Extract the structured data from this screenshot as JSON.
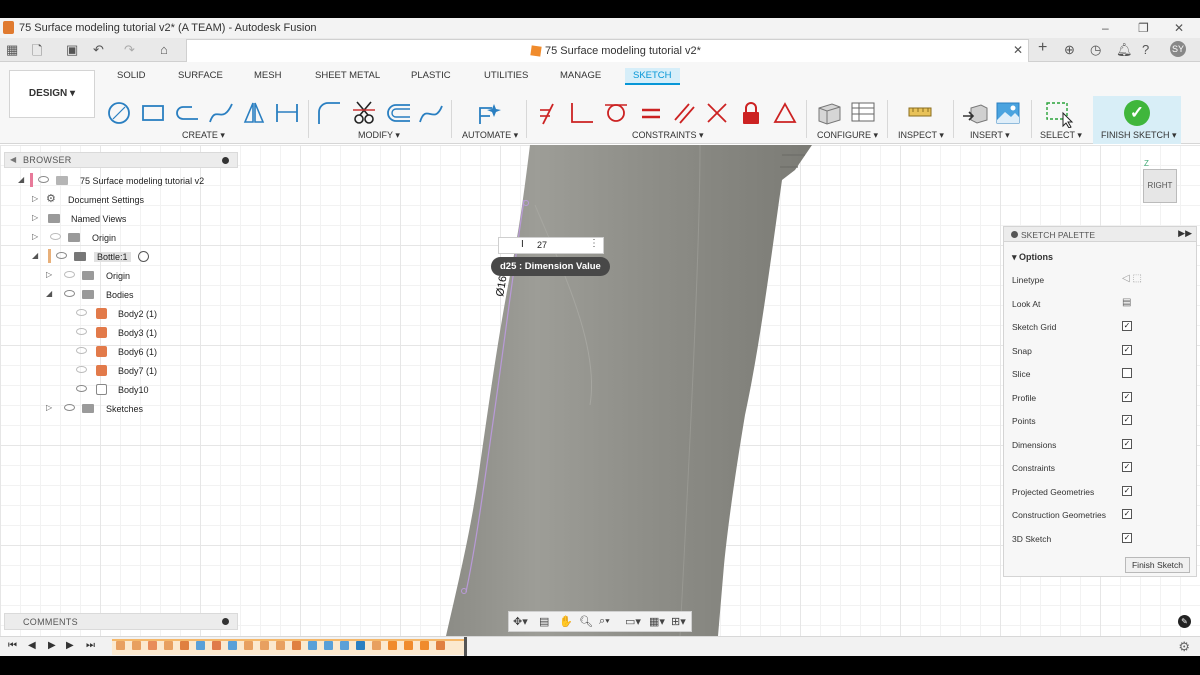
{
  "window": {
    "title": "75 Surface modeling tutorial v2* (A TEAM) - Autodesk Fusion",
    "controls": [
      "–",
      "❐",
      "✕"
    ]
  },
  "tab": {
    "document_name": "75 Surface modeling tutorial v2*",
    "close": "✕"
  },
  "toolbar": {
    "workspace_button": "DESIGN ▾",
    "workspace_tabs": [
      "SOLID",
      "SURFACE",
      "MESH",
      "SHEET METAL",
      "PLASTIC",
      "UTILITIES",
      "MANAGE",
      "SKETCH"
    ],
    "active_tab": "SKETCH",
    "groups": [
      "CREATE ▾",
      "MODIFY ▾",
      "AUTOMATE ▾",
      "CONSTRAINTS ▾",
      "CONFIGURE ▾",
      "INSPECT ▾",
      "INSERT ▾",
      "SELECT ▾"
    ],
    "finish_sketch": "FINISH SKETCH ▾",
    "accent": "#0696d7",
    "finish_color": "#40b63c"
  },
  "browser": {
    "title": "BROWSER",
    "items": [
      {
        "label": "75 Surface modeling tutorial v2"
      },
      {
        "label": "Document Settings"
      },
      {
        "label": "Named Views"
      },
      {
        "label": "Origin"
      },
      {
        "label": "Bottle:1"
      },
      {
        "label": "Origin"
      },
      {
        "label": "Bodies"
      },
      {
        "label": "Body2 (1)"
      },
      {
        "label": "Body3 (1)"
      },
      {
        "label": "Body6 (1)"
      },
      {
        "label": "Body7 (1)"
      },
      {
        "label": "Body10"
      },
      {
        "label": "Sketches"
      }
    ]
  },
  "comments": {
    "title": "COMMENTS"
  },
  "dimension": {
    "input_value": "27",
    "tooltip": "d25 : Dimension Value",
    "canvas_label": "Ø16"
  },
  "viewcube": {
    "face": "RIGHT",
    "axis": "Z"
  },
  "sketch_palette": {
    "title": "SKETCH PALETTE",
    "section": "Options",
    "options": [
      {
        "label": "Linetype",
        "type": "icons"
      },
      {
        "label": "Look At",
        "type": "icon"
      },
      {
        "label": "Sketch Grid",
        "checked": true
      },
      {
        "label": "Snap",
        "checked": true
      },
      {
        "label": "Slice",
        "checked": false
      },
      {
        "label": "Profile",
        "checked": true
      },
      {
        "label": "Points",
        "checked": true
      },
      {
        "label": "Dimensions",
        "checked": true
      },
      {
        "label": "Constraints",
        "checked": true
      },
      {
        "label": "Projected Geometries",
        "checked": true
      },
      {
        "label": "Construction Geometries",
        "checked": true
      },
      {
        "label": "3D Sketch",
        "checked": true
      }
    ],
    "finish_button": "Finish Sketch"
  }
}
